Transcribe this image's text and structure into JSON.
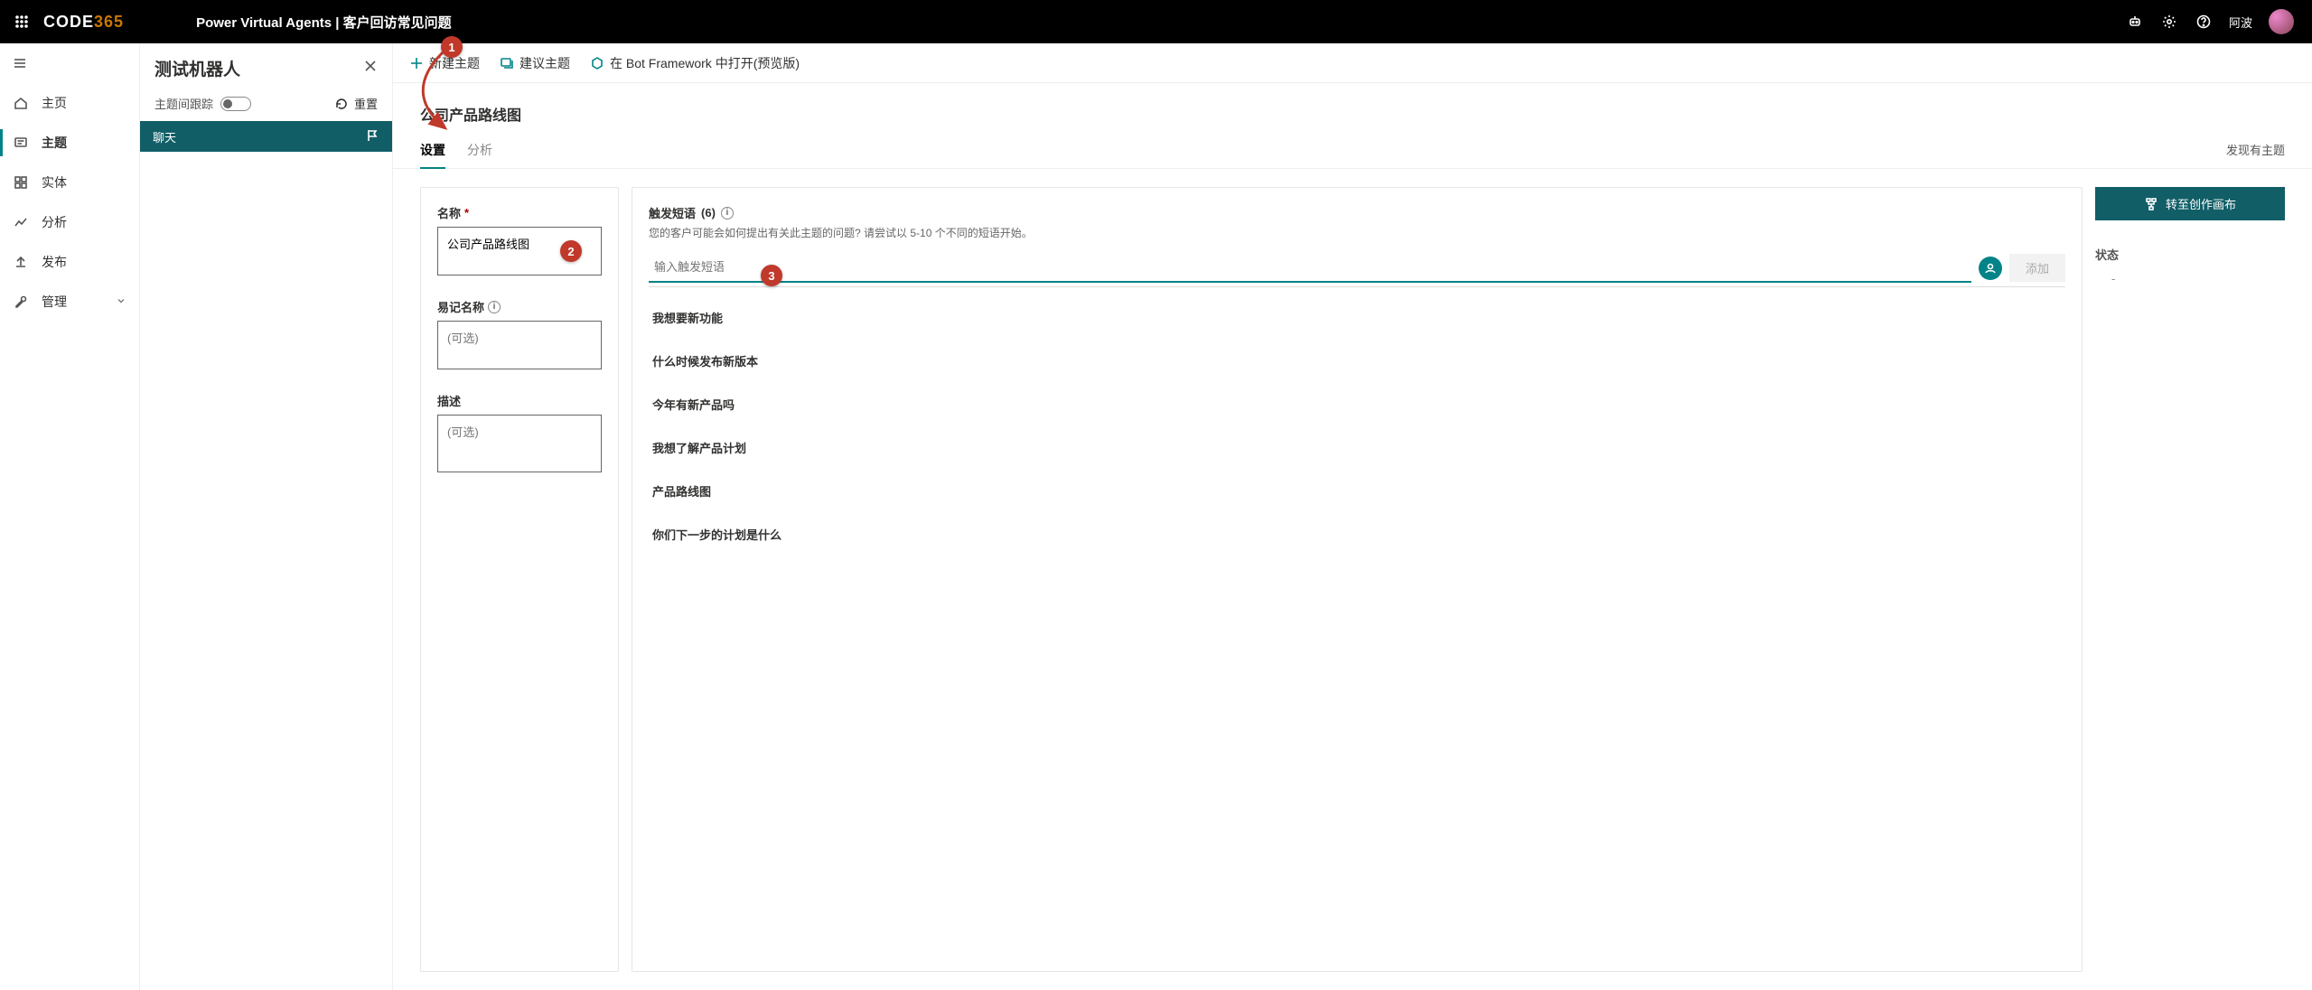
{
  "topbar": {
    "logo_main": "CODE",
    "logo_accent": "365",
    "title": "Power Virtual Agents | 客户回访常见问题",
    "user_label": "阿波"
  },
  "rail": {
    "items": [
      {
        "icon": "home",
        "label": "主页"
      },
      {
        "icon": "topics",
        "label": "主题"
      },
      {
        "icon": "entities",
        "label": "实体"
      },
      {
        "icon": "analytics",
        "label": "分析"
      },
      {
        "icon": "publish",
        "label": "发布"
      },
      {
        "icon": "manage",
        "label": "管理",
        "chevron": true
      }
    ],
    "active_index": 1
  },
  "testpanel": {
    "heading": "测试机器人",
    "track_label": "主题间跟踪",
    "reset_label": "重置",
    "chat_label": "聊天"
  },
  "cmdbar": {
    "new_topic": "新建主题",
    "suggest_topic": "建议主题",
    "open_bf": "在 Bot Framework 中打开(预览版)"
  },
  "topic": {
    "title": "公司产品路线图"
  },
  "tabs": {
    "settings": "设置",
    "analytics": "分析",
    "right_hint": "发现有主题"
  },
  "form": {
    "name_label": "名称",
    "name_value": "公司产品路线图",
    "friendly_label": "易记名称",
    "friendly_placeholder": "(可选)",
    "desc_label": "描述",
    "desc_placeholder": "(可选)"
  },
  "trigger": {
    "heading": "触发短语",
    "count": "(6)",
    "sub": "您的客户可能会如何提出有关此主题的问题? 请尝试以 5-10 个不同的短语开始。",
    "input_placeholder": "输入触发短语",
    "add_label": "添加",
    "phrases": [
      "我想要新功能",
      "什么时候发布新版本",
      "今年有新产品吗",
      "我想了解产品计划",
      "产品路线图",
      "你们下一步的计划是什么"
    ]
  },
  "right": {
    "goto_canvas": "转至创作画布",
    "status_label": "状态",
    "status_value": "-"
  },
  "callouts": {
    "c1": "1",
    "c2": "2",
    "c3": "3"
  }
}
